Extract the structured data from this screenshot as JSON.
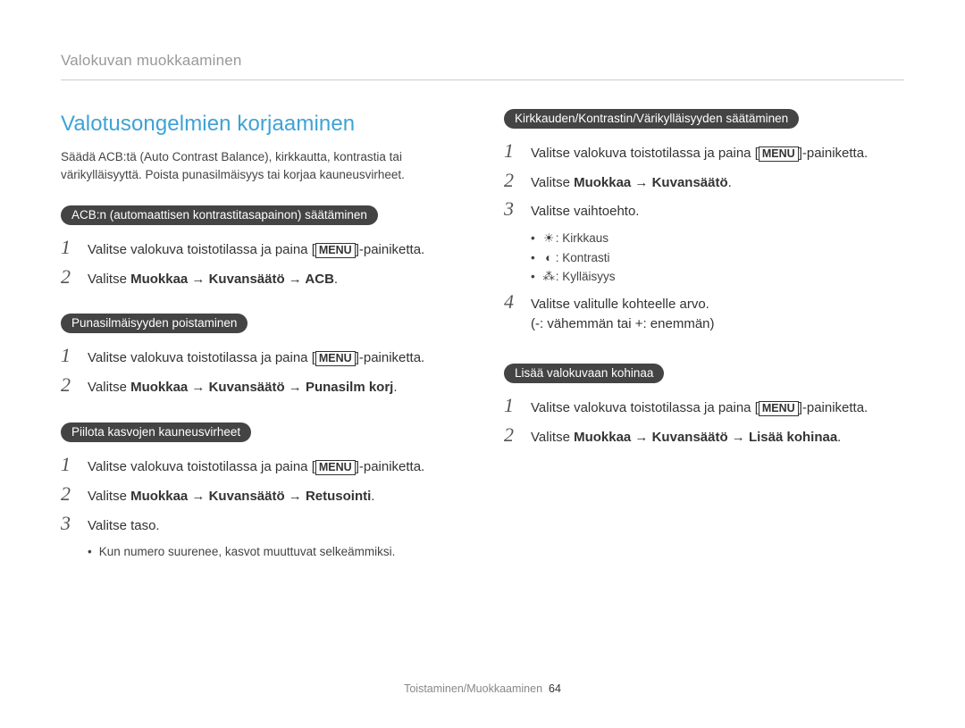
{
  "header": "Valokuvan muokkaaminen",
  "section_title": "Valotusongelmien korjaaminen",
  "intro": "Säädä ACB:tä (Auto Contrast Balance), kirkkautta, kontrastia tai värikylläisyyttä. Poista punasilmäisyys tai korjaa kauneusvirheet.",
  "left": {
    "acb": {
      "pill": "ACB:n (automaattisen kontrastitasapainon) säätäminen",
      "steps": [
        {
          "n": "1",
          "pre": "Valitse valokuva toistotilassa ja paina [",
          "menu": "MENU",
          "post": "]-painiketta."
        },
        {
          "n": "2",
          "pre": "Valitse ",
          "bold": "Muokkaa → Kuvansäätö → ACB",
          "post": "."
        }
      ]
    },
    "redeye": {
      "pill": "Punasilmäisyyden poistaminen",
      "steps": [
        {
          "n": "1",
          "pre": "Valitse valokuva toistotilassa ja paina [",
          "menu": "MENU",
          "post": "]-painiketta."
        },
        {
          "n": "2",
          "pre": "Valitse ",
          "bold": "Muokkaa → Kuvansäätö → Punasilm korj",
          "post": "."
        }
      ]
    },
    "retouch": {
      "pill": "Piilota kasvojen kauneusvirheet",
      "steps": [
        {
          "n": "1",
          "pre": "Valitse valokuva toistotilassa ja paina [",
          "menu": "MENU",
          "post": "]-painiketta."
        },
        {
          "n": "2",
          "pre": "Valitse ",
          "bold": "Muokkaa → Kuvansäätö → Retusointi",
          "post": "."
        },
        {
          "n": "3",
          "pre": "Valitse taso."
        }
      ],
      "bullet": "Kun numero suurenee, kasvot muuttuvat selkeämmiksi."
    }
  },
  "right": {
    "bcs": {
      "pill": "Kirkkauden/Kontrastin/Värikylläisyyden säätäminen",
      "steps": [
        {
          "n": "1",
          "pre": "Valitse valokuva toistotilassa ja paina [",
          "menu": "MENU",
          "post": "]-painiketta."
        },
        {
          "n": "2",
          "pre": "Valitse ",
          "bold": "Muokkaa → Kuvansäätö",
          "post": "."
        },
        {
          "n": "3",
          "pre": "Valitse vaihtoehto."
        }
      ],
      "options": [
        {
          "icon": "☀",
          "label": ": Kirkkaus"
        },
        {
          "icon": "◐",
          "label": ": Kontrasti"
        },
        {
          "icon": "⁂",
          "label": ": Kylläisyys"
        }
      ],
      "step4": {
        "n": "4",
        "line1": "Valitse valitulle kohteelle arvo.",
        "line2": "(-: vähemmän tai +: enemmän)"
      }
    },
    "noise": {
      "pill": "Lisää valokuvaan kohinaa",
      "steps": [
        {
          "n": "1",
          "pre": "Valitse valokuva toistotilassa ja paina [",
          "menu": "MENU",
          "post": "]-painiketta."
        },
        {
          "n": "2",
          "pre": "Valitse ",
          "bold": "Muokkaa → Kuvansäätö → Lisää kohinaa",
          "post": "."
        }
      ]
    }
  },
  "footer": {
    "label": "Toistaminen/Muokkaaminen",
    "page": "64"
  }
}
